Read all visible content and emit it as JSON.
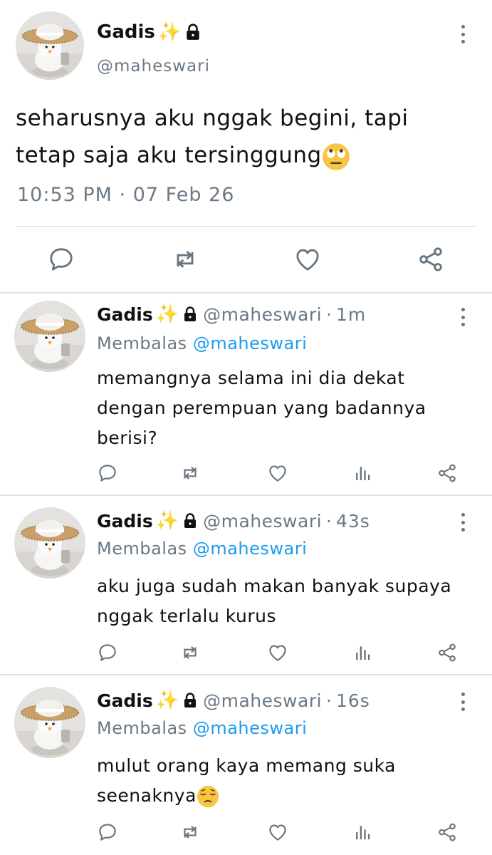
{
  "main": {
    "name": "Gadis",
    "sparkle": "✨",
    "handle": "@maheswari",
    "text_line1": "seharusnya aku nggak begini, tapi",
    "text_line2": "tetap saja aku tersinggung",
    "emoji": "eye-roll-emoji",
    "timestamp": "10:53 PM · 07 Feb 26"
  },
  "replies": [
    {
      "name": "Gadis",
      "sparkle": "✨",
      "handle": "@maheswari",
      "separator": "·",
      "age": "1m",
      "reply_prefix": "Membalas",
      "reply_to": "@maheswari",
      "lines": [
        "memangnya selama ini dia dekat",
        "dengan perempuan yang badannya",
        "berisi?"
      ]
    },
    {
      "name": "Gadis",
      "sparkle": "✨",
      "handle": "@maheswari",
      "separator": "·",
      "age": "43s",
      "reply_prefix": "Membalas",
      "reply_to": "@maheswari",
      "lines": [
        "aku juga sudah makan banyak supaya",
        "nggak terlalu kurus"
      ]
    },
    {
      "name": "Gadis",
      "sparkle": "✨",
      "handle": "@maheswari",
      "separator": "·",
      "age": "16s",
      "reply_prefix": "Membalas",
      "reply_to": "@maheswari",
      "lines": [
        "mulut orang kaya memang suka",
        "seenaknya"
      ],
      "emoji": "pensive-emoji"
    }
  ],
  "colors": {
    "text": "#111111",
    "muted": "#6b7985",
    "link": "#1d9bf0",
    "divider": "#d6dde3",
    "sparkle": "#f7c52b"
  }
}
